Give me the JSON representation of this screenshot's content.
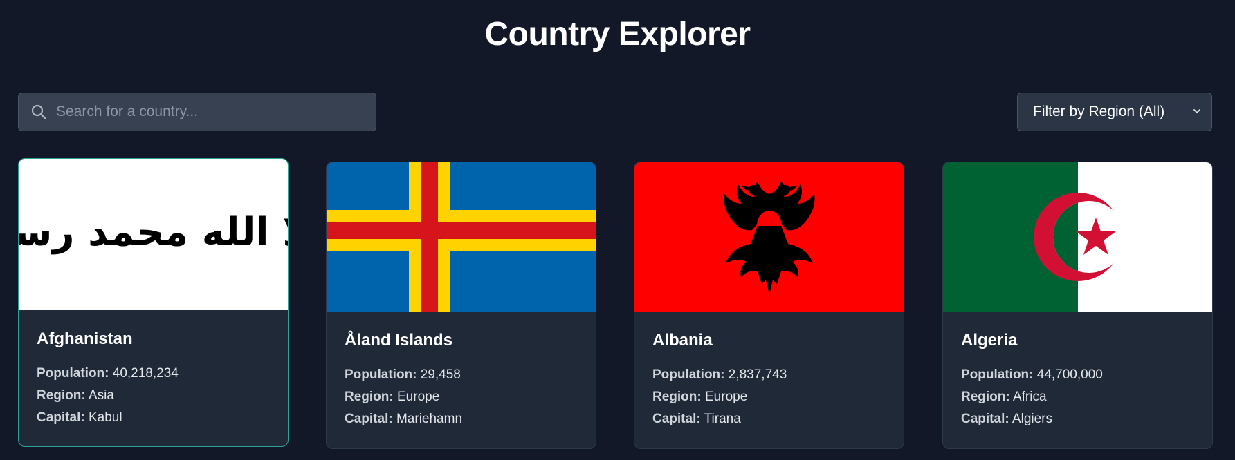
{
  "page": {
    "title": "Country Explorer"
  },
  "search": {
    "placeholder": "Search for a country..."
  },
  "filter": {
    "label": "Filter by Region (All)"
  },
  "labels": {
    "population": "Population:",
    "region": "Region:",
    "capital": "Capital:"
  },
  "colors": {
    "background": "#121827",
    "card": "#1f2937",
    "active_border": "#2fa39a",
    "aland_blue": "#0064ad",
    "aland_yellow": "#ffd200",
    "aland_red": "#d6141c",
    "albania_red": "#ff0000",
    "algeria_green": "#006233",
    "algeria_red": "#d21034"
  },
  "countries": [
    {
      "name": "Afghanistan",
      "population": "40,218,234",
      "region": "Asia",
      "capital": "Kabul",
      "flag": "afghanistan-flag",
      "flag_text": "لا إله إلا الله محمد رسول الله"
    },
    {
      "name": "Åland Islands",
      "population": "29,458",
      "region": "Europe",
      "capital": "Mariehamn",
      "flag": "aland-flag"
    },
    {
      "name": "Albania",
      "population": "2,837,743",
      "region": "Europe",
      "capital": "Tirana",
      "flag": "albania-flag"
    },
    {
      "name": "Algeria",
      "population": "44,700,000",
      "region": "Africa",
      "capital": "Algiers",
      "flag": "algeria-flag"
    }
  ]
}
